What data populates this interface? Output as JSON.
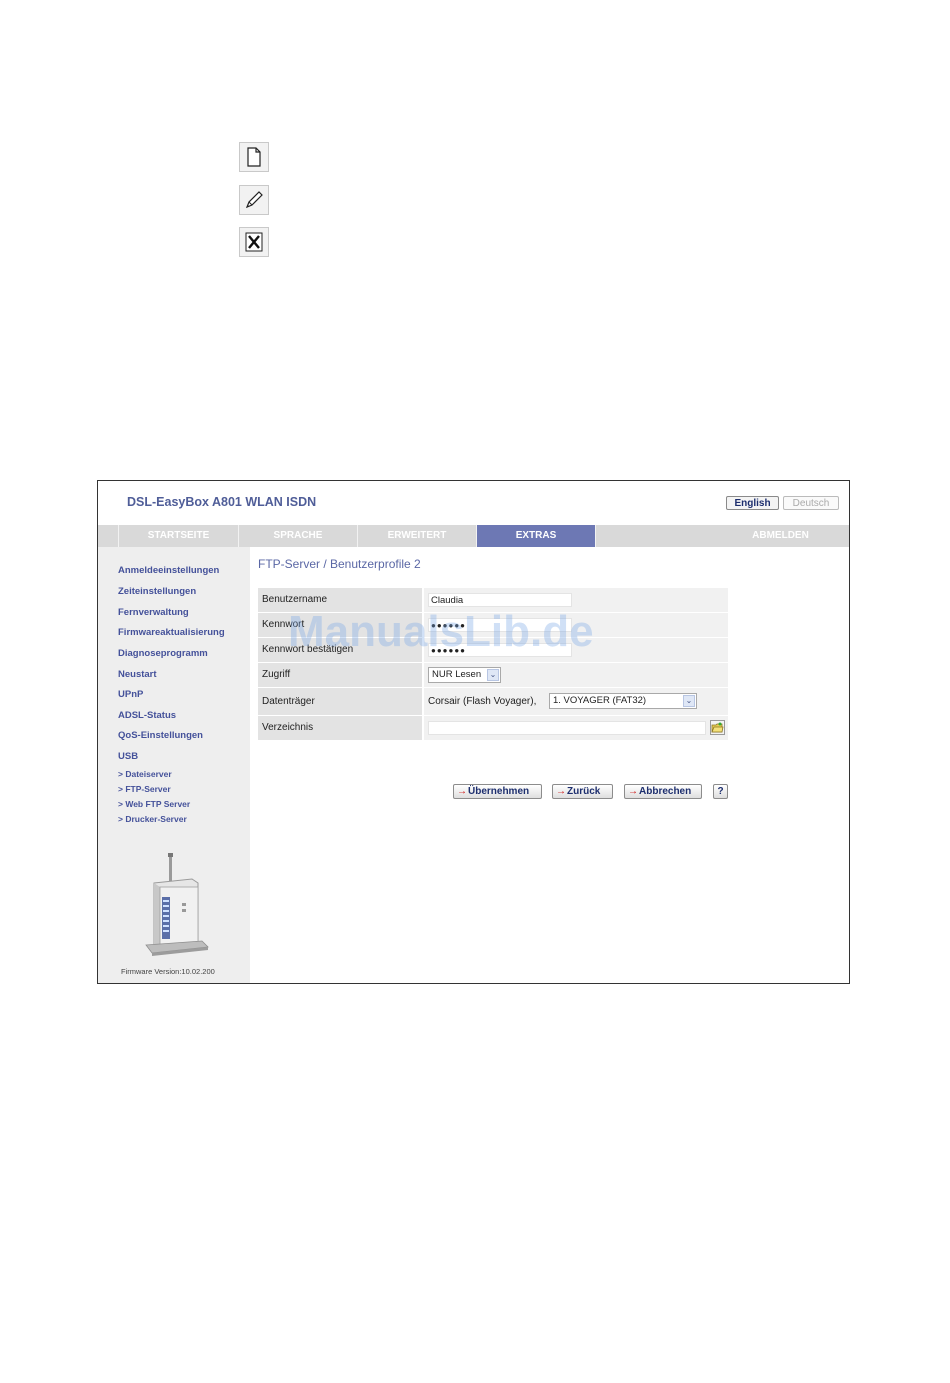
{
  "toolbar_icons": [
    {
      "icon": "new-document-icon"
    },
    {
      "icon": "edit-pencil-icon"
    },
    {
      "icon": "delete-x-icon"
    }
  ],
  "app": {
    "title": "DSL-EasyBox A801 WLAN ISDN",
    "lang_english": "English",
    "lang_deutsch": "Deutsch"
  },
  "nav": {
    "startseite": "STARTSEITE",
    "sprache": "SPRACHE",
    "erweitert": "ERWEITERT",
    "extras": "EXTRAS",
    "abmelden": "ABMELDEN",
    "active": "EXTRAS"
  },
  "sidebar": {
    "items": [
      "Anmeldeeinstellungen",
      "Zeiteinstellungen",
      "Fernverwaltung",
      "Firmwareaktualisierung",
      "Diagnoseprogramm",
      "Neustart",
      "UPnP",
      "ADSL-Status",
      "QoS-Einstellungen",
      "USB"
    ],
    "usb_sub": [
      "> Dateiserver",
      "> FTP-Server",
      "> Web FTP Server",
      "> Drucker-Server"
    ],
    "firmware": "Firmware Version:10.02.200"
  },
  "page": {
    "title": "FTP-Server / Benutzerprofile 2"
  },
  "form": {
    "username_label": "Benutzername",
    "username_value": "Claudia",
    "password_label": "Kennwort",
    "password_value": "●●●●●●",
    "password_confirm_label": "Kennwort bestätigen",
    "password_confirm_value": "●●●●●●",
    "access_label": "Zugriff",
    "access_value": "NUR Lesen",
    "media_label": "Datenträger",
    "media_device": "Corsair (Flash Voyager),",
    "media_partition": "1. VOYAGER (FAT32)",
    "directory_label": "Verzeichnis",
    "directory_value": ""
  },
  "buttons": {
    "apply": "Übernehmen",
    "back": "Zurück",
    "cancel": "Abbrechen",
    "help": "?"
  },
  "watermark": "ManualsLib.de",
  "colors": {
    "brand_blue": "#4f5d98",
    "nav_active": "#6d78b4",
    "nav_bar": "#d9d9d9",
    "sidebar_bg": "#eeeeee"
  }
}
